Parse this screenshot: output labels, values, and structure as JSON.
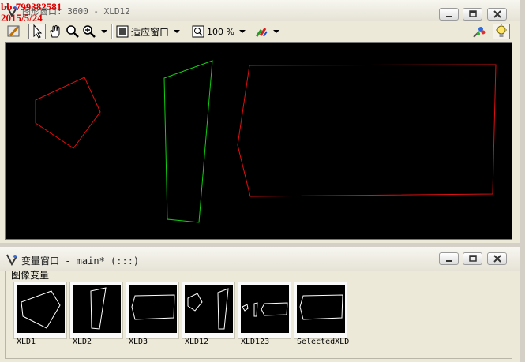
{
  "graphics_window": {
    "title": "图形窗口: 3600 - XLD12",
    "toolbar": {
      "fit_label": "适应窗口",
      "zoom_label": "100 %"
    }
  },
  "variable_window": {
    "title": "变量窗口 - main* (:::)",
    "group_title": "图像变量",
    "thumbnails": [
      {
        "label": "XLD1"
      },
      {
        "label": "XLD2"
      },
      {
        "label": "XLD3"
      },
      {
        "label": "XLD12"
      },
      {
        "label": "XLD123"
      },
      {
        "label": "SelectedXLD"
      }
    ]
  },
  "watermark": {
    "line1": "bb-799382581",
    "line2": "2015/5/24"
  },
  "colors": {
    "red_contour": "#e01010",
    "green_contour": "#10d010",
    "canvas_bg": "#000000"
  },
  "icons": [
    "graphics-window-icon",
    "pencil-icon",
    "pointer-icon",
    "hand-icon",
    "zoom-icon",
    "zoom-plus-icon",
    "fit-window-icon",
    "zoom-percent-icon",
    "color-brush-icon",
    "region-colors-icon",
    "lightbulb-icon",
    "minimize-icon",
    "restore-icon",
    "close-icon"
  ]
}
